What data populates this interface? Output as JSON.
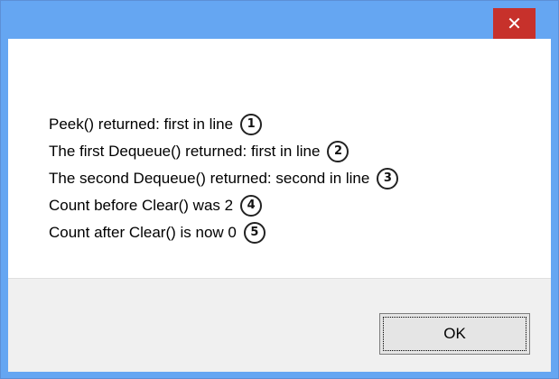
{
  "window": {
    "title": "",
    "close_glyph": "✕"
  },
  "message": {
    "lines": [
      {
        "text": "Peek() returned: first in line",
        "callout": "1"
      },
      {
        "text": "The first Dequeue() returned: first in line",
        "callout": "2"
      },
      {
        "text": "The second Dequeue() returned: second in line",
        "callout": "3"
      },
      {
        "text": "Count before Clear() was 2",
        "callout": "4"
      },
      {
        "text": "Count after Clear() is now 0",
        "callout": "5"
      }
    ]
  },
  "buttons": {
    "ok_label": "OK"
  },
  "colors": {
    "title_bar": "#65a6f2",
    "close_button": "#c7312b",
    "button_bar": "#f0f0f0"
  }
}
